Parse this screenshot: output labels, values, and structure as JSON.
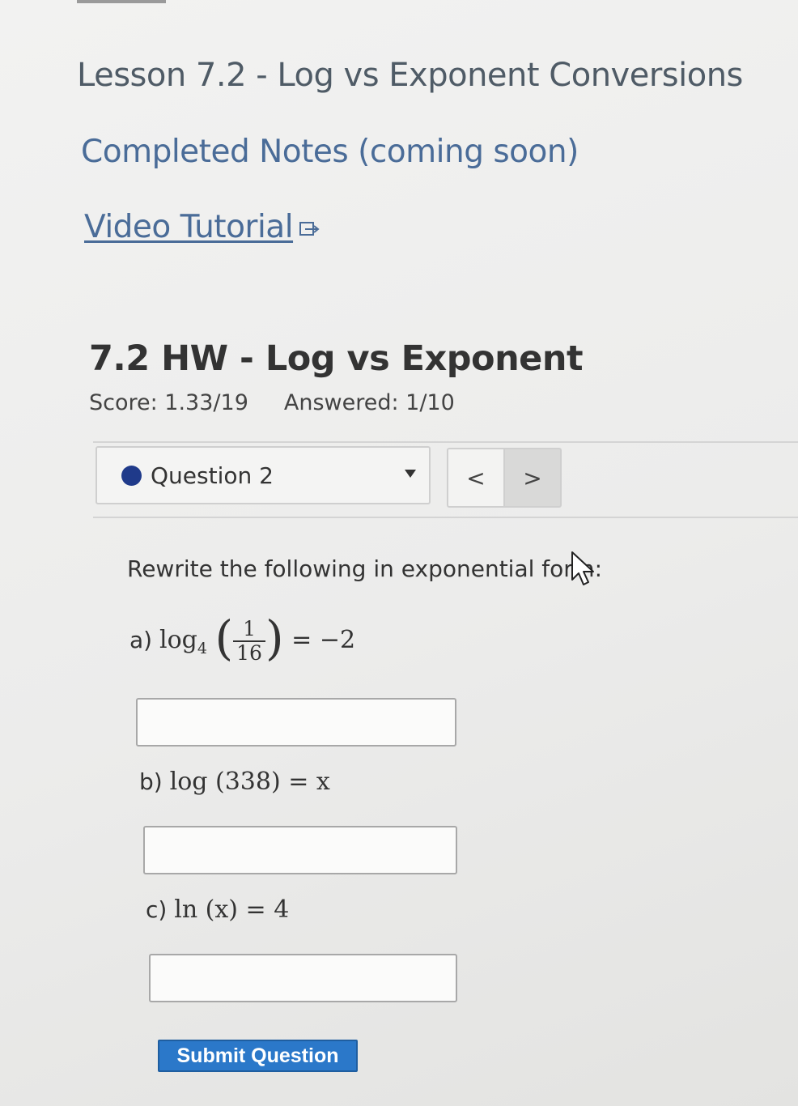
{
  "lesson": {
    "title": "Lesson 7.2 - Log vs Exponent Conversions",
    "notes_link": "Completed Notes (coming soon)",
    "video_link": "Video Tutorial"
  },
  "homework": {
    "title": "7.2 HW - Log vs Exponent",
    "score": "Score: 1.33/19",
    "answered": "Answered: 1/10"
  },
  "question_nav": {
    "selected": "Question 2",
    "prev_label": "<",
    "next_label": ">"
  },
  "question": {
    "prompt": "Rewrite the following in exponential form:",
    "parts": [
      {
        "label": "a)",
        "func": "log",
        "base": "4",
        "numerator": "1",
        "denominator": "16",
        "rhs": "= −2"
      },
      {
        "label": "b)",
        "expr": "log (338) = x"
      },
      {
        "label": "c)",
        "expr": "ln (x) = 4"
      }
    ],
    "answers": [
      "",
      "",
      ""
    ]
  },
  "submit_label": "Submit Question",
  "colors": {
    "link": "#4a6c98",
    "submit": "#2b78c9",
    "status_dot": "#1f3a8a"
  },
  "icons": {
    "external": "external-link-icon",
    "caret": "chevron-down-icon",
    "cursor": "mouse-pointer-icon"
  }
}
